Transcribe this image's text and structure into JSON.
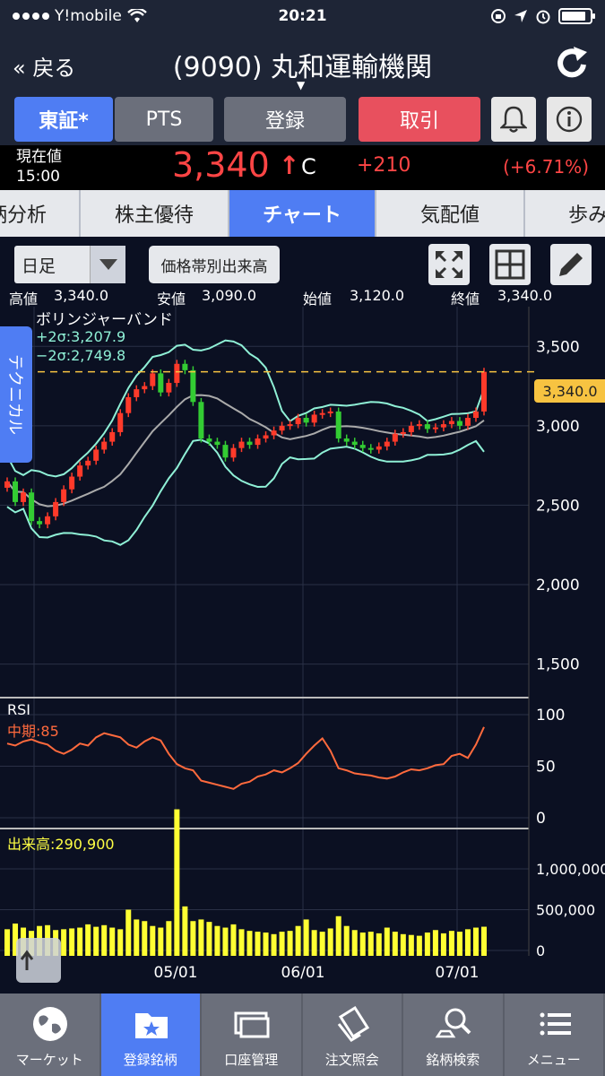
{
  "status": {
    "carrier": "Y!mobile",
    "time": "20:21"
  },
  "header": {
    "back": "« 戻る",
    "title": "(9090) 丸和運輸機関"
  },
  "buttons": {
    "tse": "東証*",
    "pts": "PTS",
    "register": "登録",
    "trade": "取引"
  },
  "quote": {
    "label_line1": "現在値",
    "label_line2": "15:00",
    "price": "3,340",
    "arrow": "↑",
    "flag": "C",
    "change": "+210",
    "change_pct": "(+6.71%)"
  },
  "tabs": [
    "銘柄分析",
    "株主優待",
    "チャート",
    "気配値",
    "歩み値"
  ],
  "controls": {
    "period": "日足",
    "volume_by_price": "価格帯別出来高"
  },
  "ohlc": {
    "high_label": "高値",
    "high": "3,340.0",
    "low_label": "安値",
    "low": "3,090.0",
    "open_label": "始値",
    "open": "3,120.0",
    "close_label": "終値",
    "close": "3,340.0"
  },
  "side_tab": "テクニカル",
  "chart_data": {
    "type": "candlestick",
    "indicator_title": "ボリンジャーバンド",
    "bb_upper": "+2σ:3,207.9",
    "bb_lower": "−2σ:2,749.8",
    "price_axis": [
      "3,500",
      "3,000",
      "2,500",
      "2,000",
      "1,500"
    ],
    "price_tag": "3,340.0",
    "rsi_title": "RSI",
    "rsi_label": "中期:85",
    "rsi_axis": [
      "100",
      "50",
      "0"
    ],
    "volume_label": "出来高:290,900",
    "volume_axis": [
      "1,000,000",
      "500,000",
      "0"
    ],
    "x_labels": [
      "05/01",
      "06/01",
      "07/01"
    ],
    "ylim": [
      1300,
      3750
    ],
    "closes": [
      2650,
      2520,
      2580,
      2400,
      2380,
      2430,
      2520,
      2600,
      2680,
      2750,
      2780,
      2850,
      2900,
      2960,
      3080,
      3180,
      3230,
      3250,
      3330,
      3210,
      3270,
      3390,
      3350,
      3150,
      2920,
      2900,
      2880,
      2800,
      2860,
      2900,
      2880,
      2920,
      2940,
      2970,
      3000,
      3010,
      3050,
      3020,
      3070,
      3080,
      3090,
      2920,
      2900,
      2880,
      2860,
      2850,
      2870,
      2900,
      2950,
      2960,
      3000,
      3010,
      2980,
      2990,
      3010,
      3030,
      3000,
      3050,
      3090,
      3340
    ],
    "rsi": [
      72,
      70,
      74,
      76,
      73,
      71,
      65,
      62,
      66,
      72,
      70,
      78,
      82,
      80,
      78,
      71,
      68,
      74,
      78,
      75,
      62,
      52,
      48,
      46,
      36,
      34,
      32,
      30,
      28,
      33,
      35,
      40,
      42,
      46,
      44,
      48,
      53,
      62,
      70,
      77,
      65,
      48,
      46,
      43,
      42,
      41,
      39,
      38,
      40,
      44,
      47,
      46,
      48,
      51,
      52,
      60,
      62,
      58,
      71,
      88
    ],
    "volume": [
      260000,
      330000,
      280000,
      240000,
      300000,
      310000,
      250000,
      260000,
      270000,
      280000,
      320000,
      290000,
      310000,
      280000,
      260000,
      500000,
      380000,
      360000,
      300000,
      280000,
      360000,
      1730000,
      540000,
      360000,
      380000,
      350000,
      300000,
      280000,
      320000,
      260000,
      240000,
      230000,
      220000,
      200000,
      230000,
      240000,
      300000,
      380000,
      250000,
      230000,
      270000,
      420000,
      300000,
      250000,
      220000,
      230000,
      210000,
      280000,
      230000,
      200000,
      190000,
      180000,
      220000,
      250000,
      210000,
      240000,
      230000,
      260000,
      280000,
      290900
    ]
  },
  "bottom_nav": [
    "マーケット",
    "登録銘柄",
    "口座管理",
    "注文照会",
    "銘柄検索",
    "メニュー"
  ]
}
